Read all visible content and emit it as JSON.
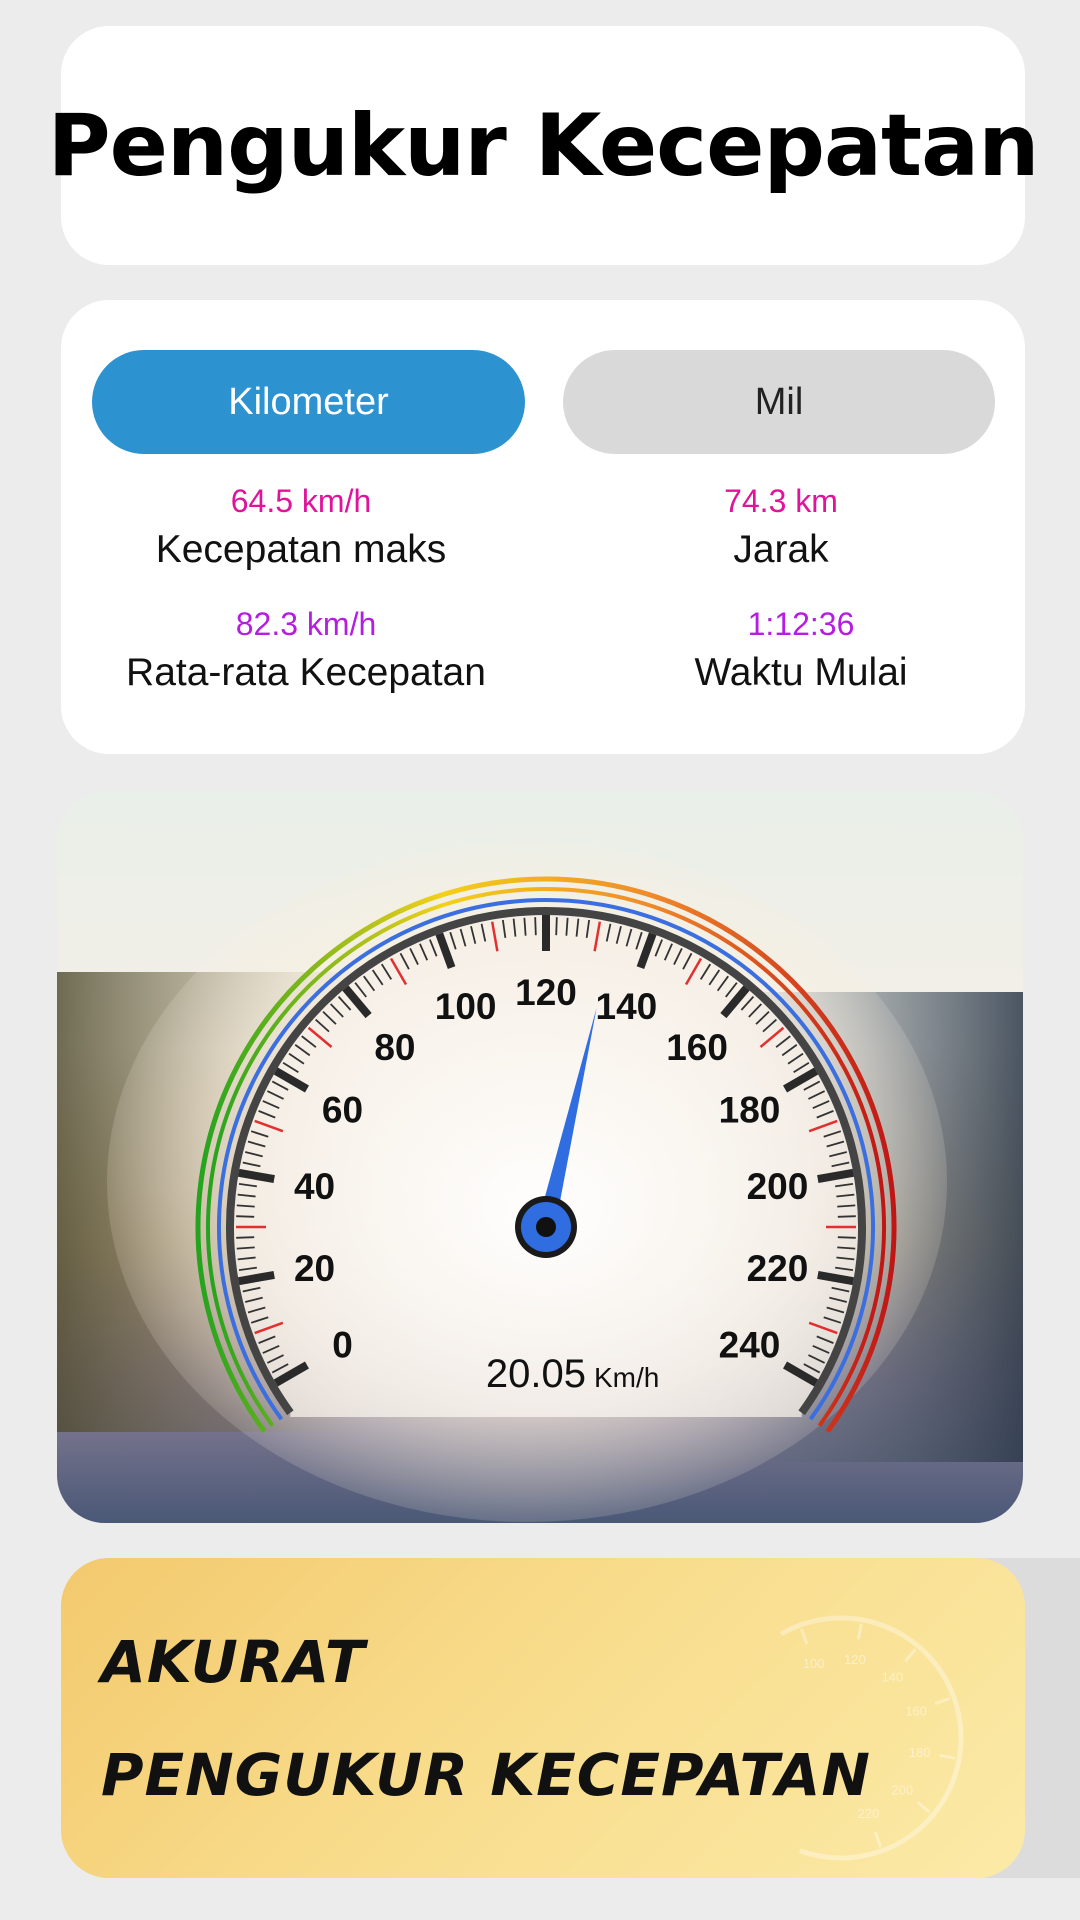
{
  "header": {
    "title": "Pengukur Kecepatan"
  },
  "units": {
    "kilometer_label": "Kilometer",
    "mile_label": "Mil",
    "selected": "Kilometer"
  },
  "stats": {
    "max_speed": {
      "value": "64.5 km/h",
      "label": "Kecepatan maks"
    },
    "distance": {
      "value": "74.3 km",
      "label": "Jarak"
    },
    "avg_speed": {
      "value": "82.3 km/h",
      "label": "Rata-rata Kecepatan"
    },
    "start_time": {
      "value": "1:12:36",
      "label": "Waktu Mulai"
    }
  },
  "gauge": {
    "ticks": [
      "0",
      "20",
      "40",
      "60",
      "80",
      "100",
      "120",
      "140",
      "160",
      "180",
      "200",
      "220",
      "240"
    ],
    "min": 0,
    "max": 240,
    "needle_value": 133,
    "speed_value": "20.05",
    "speed_unit": "Km/h"
  },
  "promo": {
    "line1": "AKURAT",
    "line2": "PENGUKUR KECEPATAN",
    "dial_ticks": [
      "100",
      "120",
      "140",
      "160",
      "180",
      "200",
      "220"
    ]
  },
  "colors": {
    "accent_blue": "#2d92d0",
    "max_speed": "#e0149a",
    "distance": "#e0149a",
    "avg_speed": "#b51de0",
    "start_time": "#b51de0",
    "needle": "#2f6de0"
  }
}
